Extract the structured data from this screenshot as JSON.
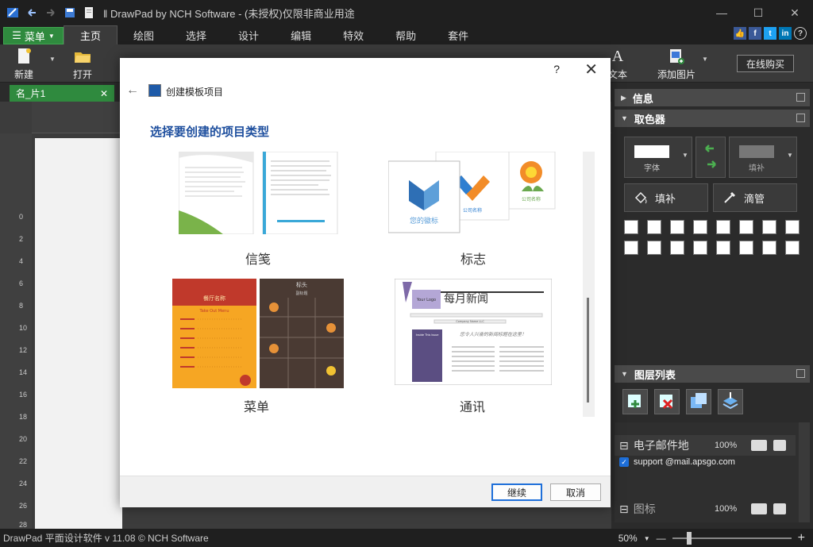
{
  "window": {
    "title": "‖ DrawPad by NCH Software - (未授权)仅限非商业用途",
    "minimize": "—",
    "maximize": "☐",
    "close": "✕"
  },
  "menu": {
    "main_button": "菜单",
    "tabs": [
      "主页",
      "绘图",
      "选择",
      "设计",
      "编辑",
      "特效",
      "帮助",
      "套件"
    ],
    "active_tab": "主页",
    "help_icon": "?"
  },
  "ribbon": {
    "new_label": "新建",
    "open_label": "打开",
    "text_label": "文本",
    "add_image_label": "添加图片",
    "buy_label": "在线购买"
  },
  "document_tab": {
    "name": "名_片1",
    "close": "✕"
  },
  "ruler": {
    "vertical_labels": [
      "0",
      "2",
      "4",
      "6",
      "8",
      "10",
      "12",
      "14",
      "16",
      "18",
      "20",
      "22",
      "24",
      "26",
      "28"
    ]
  },
  "right_panel": {
    "info_title": "信息",
    "color_picker_title": "取色器",
    "font_swatch_label": "字体",
    "fill_swatch_label": "填补",
    "fill_tool_label": "填补",
    "eyedropper_label": "滴管",
    "layers_title": "图层列表",
    "layers": [
      {
        "name": "电子邮件地",
        "opacity": "100%",
        "expand": "⊟"
      },
      {
        "name": "图标",
        "opacity": "100%",
        "expand": "⊟"
      }
    ],
    "sublayer": "support @mail.apsgo.com"
  },
  "modal": {
    "help": "?",
    "close": "✕",
    "back": "←",
    "title": "创建模板项目",
    "heading": "选择要创建的项目类型",
    "cards": [
      {
        "label": "信笺"
      },
      {
        "label": "标志"
      },
      {
        "label": "菜单"
      },
      {
        "label": "通讯"
      }
    ],
    "thumbs": {
      "logo_text": "您的徽标",
      "logo_company": "公司名称",
      "logo_company2": "公司名称",
      "menu_title": "餐厅名称",
      "menu_sub": "Take Out Menu",
      "menu2_title": "标头",
      "menu2_sub": "副标题",
      "news_title": "每月新闻",
      "news_logo": "Your Logo",
      "news_company": "Company Name LLC",
      "news_quote": "您令人兴奋的新闻标题在这里！",
      "news_inside": "Inside This Issue"
    },
    "continue_button": "继续",
    "cancel_button": "取消"
  },
  "statusbar": {
    "text": "DrawPad 平面设计软件 v 11.08 © NCH Software",
    "zoom": "50%",
    "zoom_out": "—",
    "zoom_in": "+"
  }
}
